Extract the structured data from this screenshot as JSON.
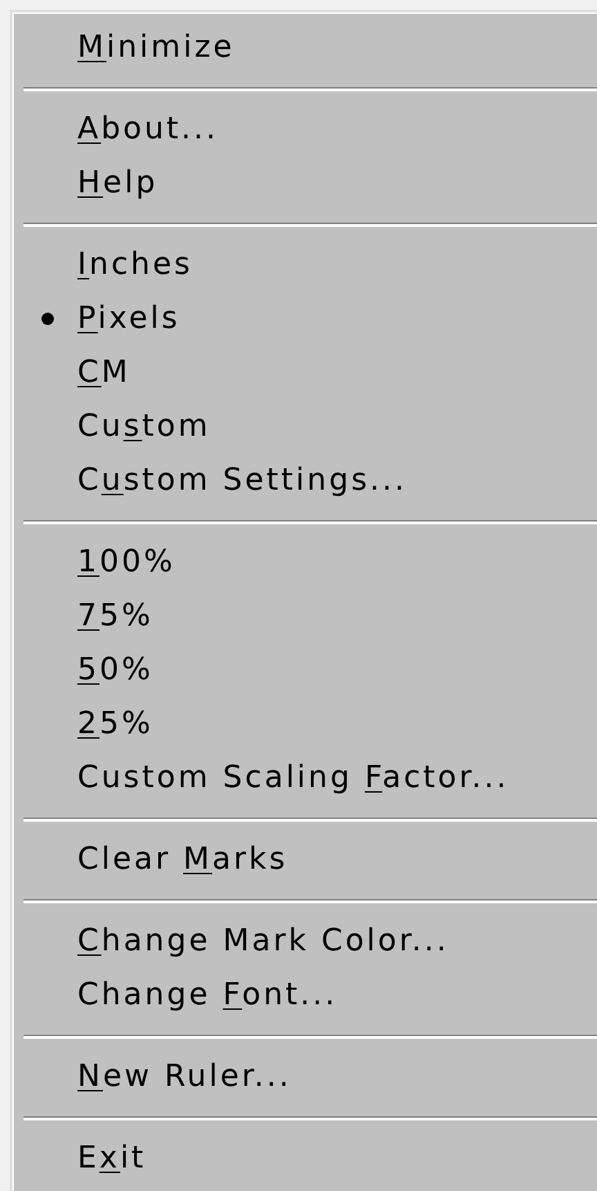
{
  "menu": {
    "items": [
      {
        "kind": "command",
        "key": "M",
        "post": "inimize"
      },
      {
        "kind": "separator"
      },
      {
        "kind": "command",
        "key": "A",
        "post": "bout..."
      },
      {
        "kind": "command",
        "key": "H",
        "post": "elp"
      },
      {
        "kind": "separator"
      },
      {
        "kind": "radio",
        "selected": false,
        "key": "I",
        "post": "nches"
      },
      {
        "kind": "radio",
        "selected": true,
        "key": "P",
        "post": "ixels"
      },
      {
        "kind": "radio",
        "selected": false,
        "key": "C",
        "post": "M"
      },
      {
        "kind": "radio",
        "selected": false,
        "pre": "Cu",
        "key": "s",
        "post": "tom"
      },
      {
        "kind": "command",
        "pre": "C",
        "key": "u",
        "post": "stom Settings..."
      },
      {
        "kind": "separator"
      },
      {
        "kind": "command",
        "key": "1",
        "post": "00%"
      },
      {
        "kind": "command",
        "key": "7",
        "post": "5%"
      },
      {
        "kind": "command",
        "key": "5",
        "post": "0%"
      },
      {
        "kind": "command",
        "key": "2",
        "post": "5%"
      },
      {
        "kind": "command",
        "pre": "Custom Scaling ",
        "key": "F",
        "post": "actor..."
      },
      {
        "kind": "separator"
      },
      {
        "kind": "command",
        "pre": "Clear ",
        "key": "M",
        "post": "arks"
      },
      {
        "kind": "separator"
      },
      {
        "kind": "command",
        "key": "C",
        "post": "hange Mark Color..."
      },
      {
        "kind": "command",
        "pre": "Change ",
        "key": "F",
        "post": "ont..."
      },
      {
        "kind": "separator"
      },
      {
        "kind": "command",
        "key": "N",
        "post": "ew Ruler..."
      },
      {
        "kind": "separator"
      },
      {
        "kind": "command",
        "pre": "E",
        "key": "x",
        "post": "it"
      }
    ]
  }
}
